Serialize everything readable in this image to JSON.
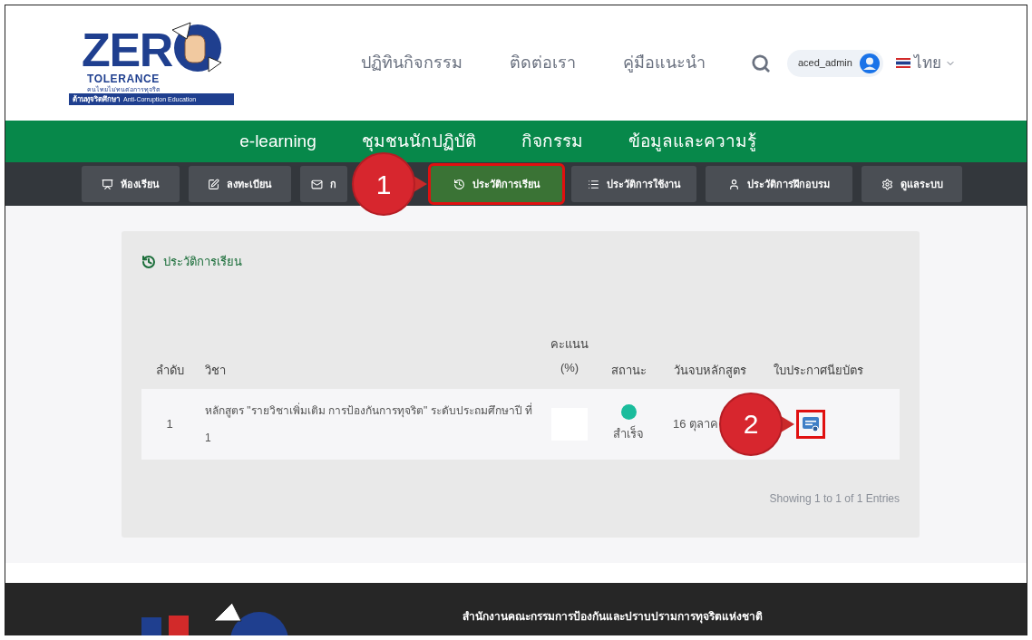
{
  "logo": {
    "letters": "ZER",
    "word": "TOLERANCE",
    "slogan": "คนไทยไม่ทนต่อการทุจริต",
    "band_thai": "ต้านทุจริตศึกษา",
    "band_english": "Anti-Corruption Education"
  },
  "top_nav": [
    "ปฏิทินกิจกรรม",
    "ติดต่อเรา",
    "คู่มือแนะนำ"
  ],
  "user": {
    "name": "aced_admin"
  },
  "language": {
    "label": "ไทย"
  },
  "main_nav": [
    "e-learning",
    "ชุมชนนักปฏิบัติ",
    "กิจกรรม",
    "ข้อมูลและความรู้"
  ],
  "tabs": [
    {
      "label": "ห้องเรียน",
      "kind": "classroom",
      "selected": false
    },
    {
      "label": "ลงทะเบียน",
      "kind": "edit",
      "selected": false
    },
    {
      "label": "ก",
      "kind": "mail",
      "selected": false
    },
    {
      "label": "ประวัติการเรียน",
      "kind": "history",
      "selected": true
    },
    {
      "label": "ประวัติการใช้งาน",
      "kind": "list",
      "selected": false
    },
    {
      "label": "ประวัติการฝึกอบรม",
      "kind": "user",
      "selected": false
    },
    {
      "label": "ดูแลระบบ",
      "kind": "gear",
      "selected": false
    }
  ],
  "panel": {
    "title": "ประวัติการเรียน",
    "table": {
      "columns": [
        "ลำดับ",
        "วิชา",
        "คะแนน (%)",
        "สถานะ",
        "วันจบหลักสูตร",
        "ใบประกาศนียบัตร"
      ],
      "rows": [
        {
          "number": "1",
          "subject": "หลักสูตร \"รายวิชาเพิ่มเติม การป้องกันการทุจริต\" ระดับประถมศึกษาปี ที่ 1",
          "status": "สำเร็จ",
          "color": "#1abc9c",
          "date": "16 ตุลาค"
        }
      ]
    },
    "footer_text": "Showing 1 to 1 of 1 Entries"
  },
  "callouts": [
    "1",
    "2"
  ],
  "footer": {
    "organization": "สำนักงานคณะกรรมการป้องกันและปราบปรามการทุจริตแห่งชาติ"
  }
}
